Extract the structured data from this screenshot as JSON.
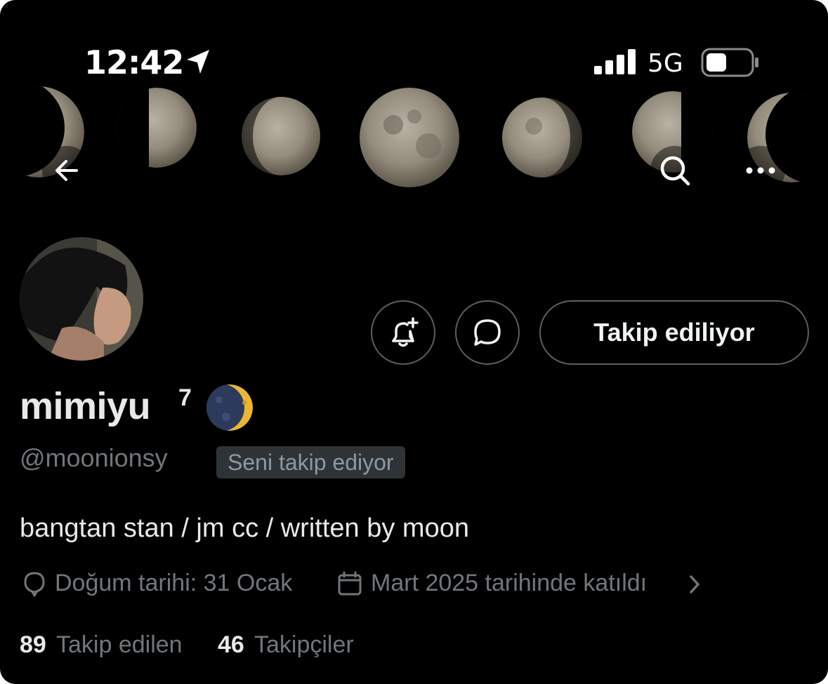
{
  "status_bar": {
    "time": "12:42",
    "network": "5G",
    "icons": [
      "location-arrow-icon",
      "signal-icon",
      "battery-icon"
    ]
  },
  "header": {
    "back_icon": "arrow-left-icon",
    "search_icon": "search-icon",
    "more_icon": "more-horizontal-icon"
  },
  "profile": {
    "display_name": "mimiyu",
    "name_superscript": "7",
    "name_emoji": "waning-crescent-moon",
    "handle": "@moonionsy",
    "follows_you_badge": "Seni takip ediyor",
    "bio": "bangtan stan / jm cc / written by moon",
    "birthday": "Doğum tarihi: 31 Ocak",
    "joined": "Mart 2025 tarihinde katıldı"
  },
  "actions": {
    "notify_icon": "bell-plus-icon",
    "message_icon": "message-bubble-icon",
    "follow_label": "Takip ediliyor"
  },
  "stats": {
    "following_count": "89",
    "following_label": "Takip edilen",
    "followers_count": "46",
    "followers_label": "Takipçiler"
  },
  "colors": {
    "background": "#000000",
    "primary_text": "#e7e9ea",
    "secondary_text": "#71767b",
    "badge_bg": "#2f3336",
    "border": "#5a5f64"
  }
}
